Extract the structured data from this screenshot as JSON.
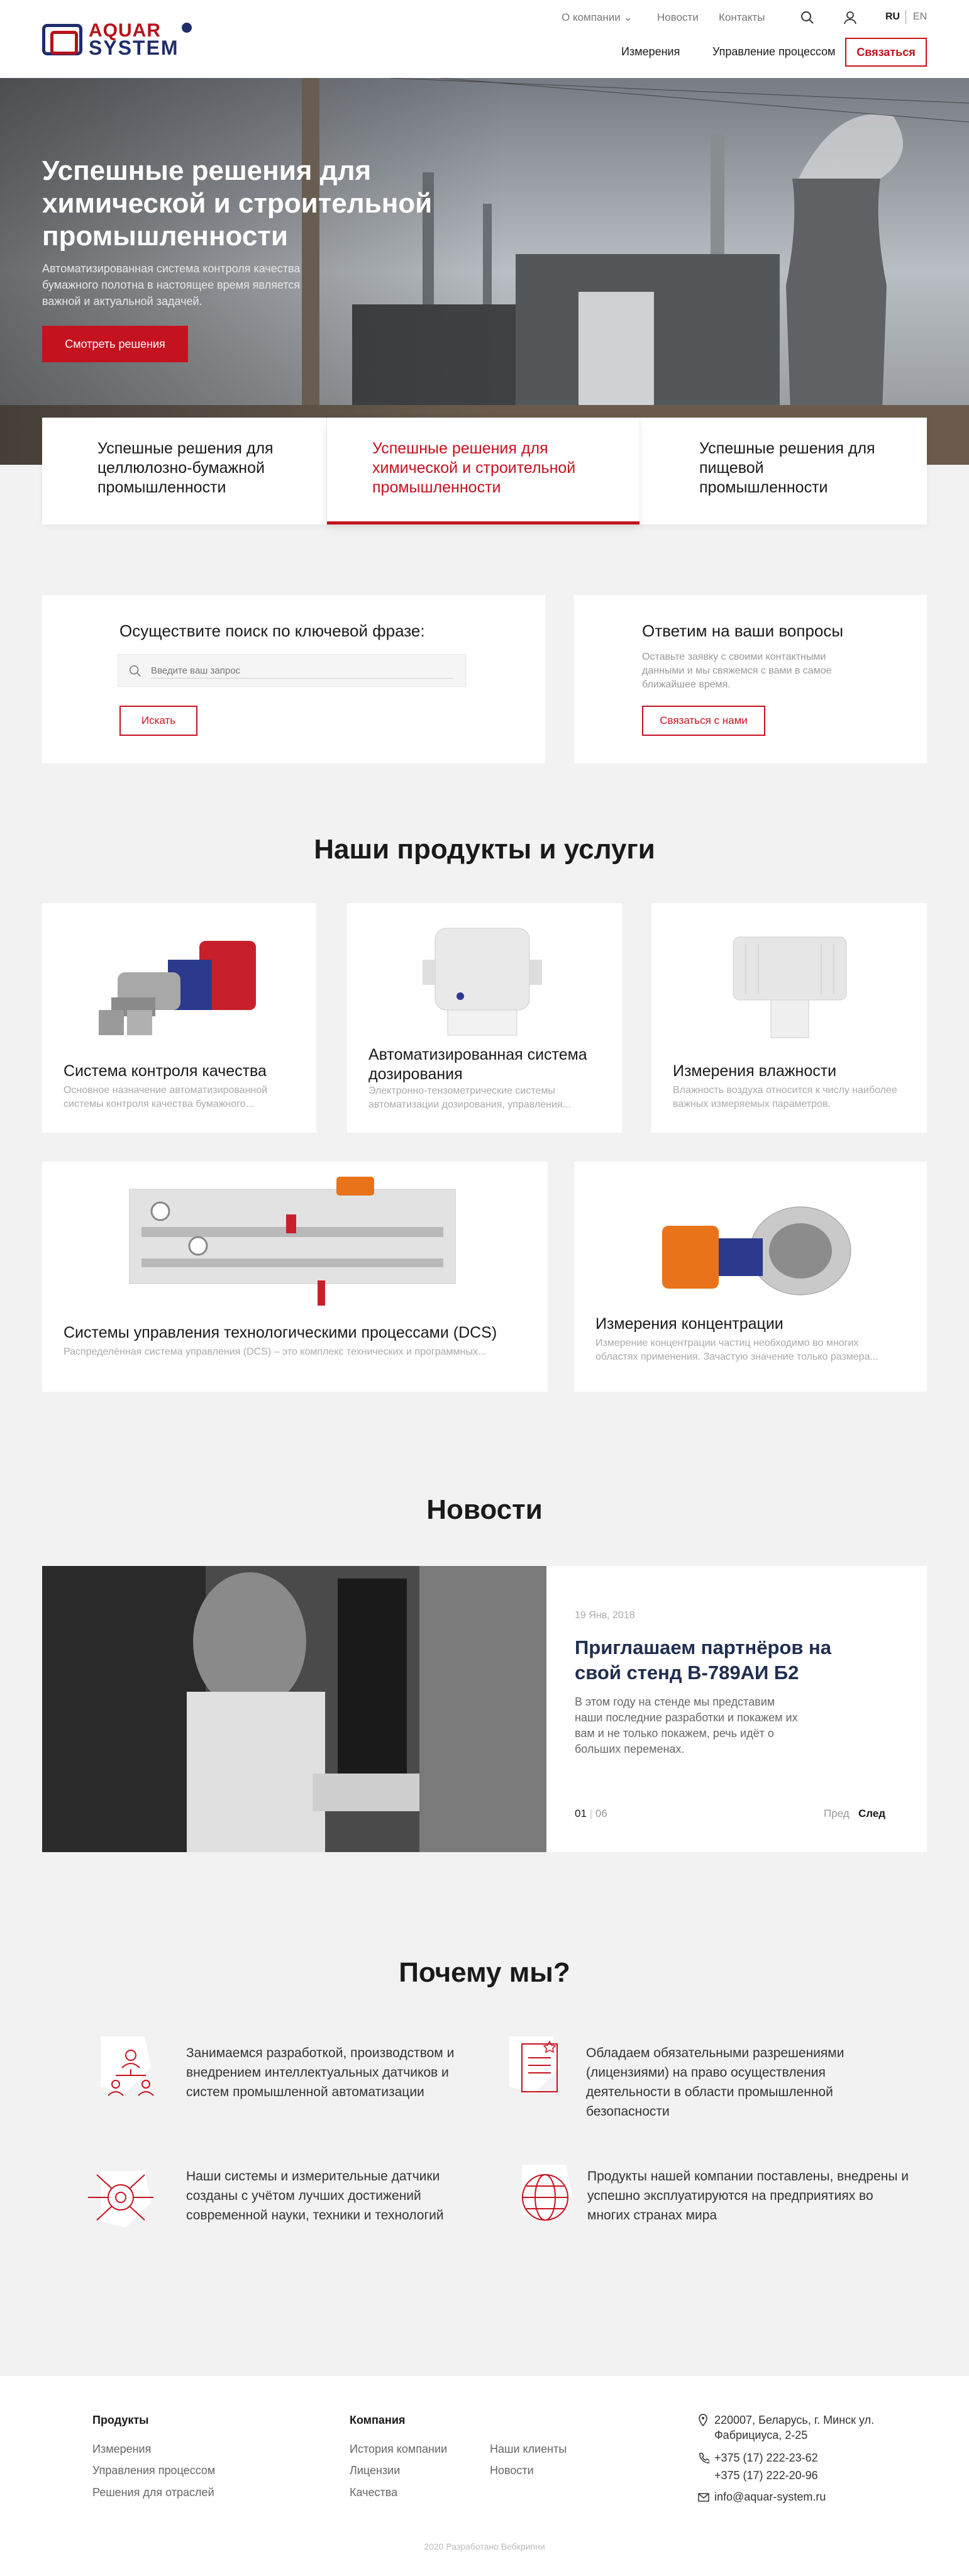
{
  "header": {
    "logo_top": "AQUAR",
    "logo_bottom": "SYSTEM",
    "topnav": {
      "about": "О компании",
      "news": "Новости",
      "contacts": "Контакты"
    },
    "lang": {
      "ru": "RU",
      "en": "EN"
    },
    "mainnav": {
      "measurements": "Измерения",
      "process_control": "Управление процессом"
    },
    "contact_button": "Связаться"
  },
  "hero": {
    "title": "Успешные решения для химической и строительной промышленности",
    "subtitle": "Автоматизированная система контроля качества бумажного полотна в настоящее время является важной и актуальной задачей.",
    "button": "Смотреть решения"
  },
  "tabs": [
    {
      "label": "Успешные решения для целлюлозно-бумажной промышленности"
    },
    {
      "label": "Успешные решения для химической и строительной промышленности"
    },
    {
      "label": "Успешные решения для пищевой промышленности"
    }
  ],
  "search": {
    "title": "Осуществите поиск по ключевой фразе:",
    "placeholder": "Введите ваш запрос",
    "button": "Искать"
  },
  "questions": {
    "title": "Ответим на ваши вопросы",
    "text": "Оставьте заявку с своими контактными данными и мы свяжемся с вами в самое ближайшее время.",
    "button": "Связаться с нами"
  },
  "products": {
    "title": "Наши продукты и услуги",
    "items": [
      {
        "title": "Система контроля качества",
        "desc": "Основное назначение автоматизированной системы контроля качества бумажного..."
      },
      {
        "title": "Автоматизированная система дозирования",
        "desc": "Электронно-тензометрические системы автоматизации дозирования, управления..."
      },
      {
        "title": "Измерения влажности",
        "desc": "Влажность воздуха относится к числу наиболее важных измеряемых параметров."
      },
      {
        "title": "Системы управления технологическими процессами (DCS)",
        "desc": "Распределённая система управления (DCS) – это комплекс технических и программных..."
      },
      {
        "title": "Измерения концентрации",
        "desc": "Измерение концентрации частиц необходимо во многих областях применения. Зачастую значение только размера..."
      }
    ]
  },
  "news": {
    "title": "Новости",
    "date": "19 Янв, 2018",
    "headline": "Приглашаем партнёров на свой стенд В-789АИ Б2",
    "text": "В этом году на стенде мы представим наши последние разработки и покажем их вам и не только покажем, речь идёт о больших переменах.",
    "counter_current": "01",
    "counter_total": "06",
    "prev": "Пред",
    "next": "След"
  },
  "why": {
    "title": "Почему мы?",
    "items": [
      {
        "text": "Занимаемся разработкой, производством и внедрением интеллектуальных датчиков и систем промышленной автоматизации"
      },
      {
        "text": "Обладаем обязательными разрешениями (лицензиями) на право осуществления деятельности в области промышленной безопасности"
      },
      {
        "text": "Наши системы и измерительные датчики созданы с учётом лучших достижений современной науки, техники и технологий"
      },
      {
        "text": "Продукты нашей компании поставлены, внедрены и успешно эксплуатируются на предприятиях во многих странах мира"
      }
    ]
  },
  "footer": {
    "products_title": "Продукты",
    "products_links": [
      "Измерения",
      "Управления процессом",
      "Решения для отраслей"
    ],
    "company_title": "Компания",
    "company_links": [
      "История компании",
      "Лицензии",
      "Качества"
    ],
    "company_links2": [
      "Наши клиенты",
      "Новости"
    ],
    "address": "220007, Беларусь, г. Минск ул. Фабрициуса, 2-25",
    "phone1": "+375 (17) 222-23-62",
    "phone2": "+375 (17) 222-20-96",
    "email": "info@aquar-system.ru",
    "copyright": "2020 Разработано Вебкрипни"
  },
  "colors": {
    "accent": "#c5121f",
    "brand_blue": "#1f2d6b"
  }
}
